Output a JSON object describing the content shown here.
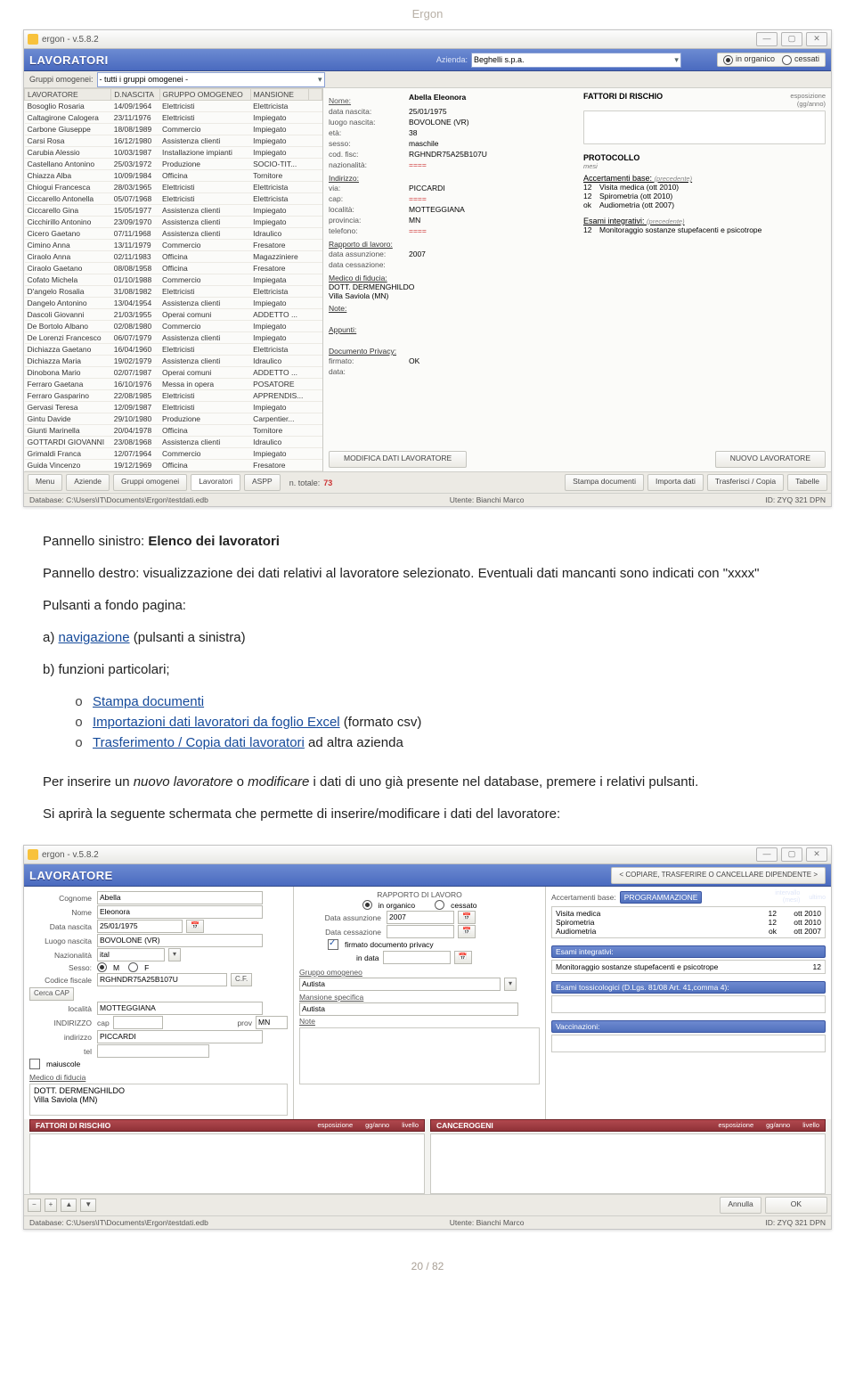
{
  "doc_header": "Ergon",
  "footer": "20 / 82",
  "app1": {
    "title": "ergon - v.5.8.2",
    "section": "LAVORATORI",
    "azienda_label": "Azienda:",
    "azienda_value": "Beghelli s.p.a.",
    "radio_in": "in organico",
    "radio_cess": "cessati",
    "groups_label": "Gruppi omogenei:",
    "groups_value": "- tutti i gruppi omogenei -",
    "headers": [
      "LAVORATORE",
      "D.NASCITA",
      "GRUPPO OMOGENEO",
      "MANSIONE"
    ],
    "rows": [
      [
        "Bosoglio Rosaria",
        "14/09/1964",
        "Elettricisti",
        "Elettricista"
      ],
      [
        "Caltagirone Calogera",
        "23/11/1976",
        "Elettricisti",
        "Impiegato"
      ],
      [
        "Carbone Giuseppe",
        "18/08/1989",
        "Commercio",
        "Impiegato"
      ],
      [
        "Carsi Rosa",
        "16/12/1980",
        "Assistenza clienti",
        "Impiegato"
      ],
      [
        "Carubia Alessio",
        "10/03/1987",
        "Installazione impianti",
        "Impiegato"
      ],
      [
        "Castellano Antonino",
        "25/03/1972",
        "Produzione",
        "SOCIO-TIT..."
      ],
      [
        "Chiazza Alba",
        "10/09/1984",
        "Officina",
        "Tornitore"
      ],
      [
        "Chiogui Francesca",
        "28/03/1965",
        "Elettricisti",
        "Elettricista"
      ],
      [
        "Ciccarello Antonella",
        "05/07/1968",
        "Elettricisti",
        "Elettricista"
      ],
      [
        "Ciccarello Gina",
        "15/05/1977",
        "Assistenza clienti",
        "Impiegato"
      ],
      [
        "Cicchirillo Antonino",
        "23/09/1970",
        "Assistenza clienti",
        "Impiegato"
      ],
      [
        "Cicero Gaetano",
        "07/11/1968",
        "Assistenza clienti",
        "Idraulico"
      ],
      [
        "Cimino Anna",
        "13/11/1979",
        "Commercio",
        "Fresatore"
      ],
      [
        "Ciraolo Anna",
        "02/11/1983",
        "Officina",
        "Magazziniere"
      ],
      [
        "Ciraolo Gaetano",
        "08/08/1958",
        "Officina",
        "Fresatore"
      ],
      [
        "Cofato Michela",
        "01/10/1988",
        "Commercio",
        "Impiegata"
      ],
      [
        "D'angelo Rosalia",
        "31/08/1982",
        "Elettricisti",
        "Elettricista"
      ],
      [
        "Dangelo Antonino",
        "13/04/1954",
        "Assistenza clienti",
        "Impiegato"
      ],
      [
        "Dascoli Giovanni",
        "21/03/1955",
        "Operai comuni",
        "ADDETTO ..."
      ],
      [
        "De Bortolo Albano",
        "02/08/1980",
        "Commercio",
        "Impiegato"
      ],
      [
        "De Lorenzi Francesco",
        "06/07/1979",
        "Assistenza clienti",
        "Impiegato"
      ],
      [
        "Dichiazza Gaetano",
        "16/04/1960",
        "Elettricisti",
        "Elettricista"
      ],
      [
        "Dichiazza Maria",
        "19/02/1979",
        "Assistenza clienti",
        "Idraulico"
      ],
      [
        "Dinobona Mario",
        "02/07/1987",
        "Operai comuni",
        "ADDETTO ..."
      ],
      [
        "Ferraro Gaetana",
        "16/10/1976",
        "Messa in opera",
        "POSATORE"
      ],
      [
        "Ferraro Gasparino",
        "22/08/1985",
        "Elettricisti",
        "APPRENDIS..."
      ],
      [
        "Gervasi Teresa",
        "12/09/1987",
        "Elettricisti",
        "Impiegato"
      ],
      [
        "Gintu Davide",
        "29/10/1980",
        "Produzione",
        "Carpentier..."
      ],
      [
        "Giunti Marinella",
        "20/04/1978",
        "Officina",
        "Tornitore"
      ],
      [
        "GOTTARDI GIOVANNI",
        "23/08/1968",
        "Assistenza clienti",
        "Idraulico"
      ],
      [
        "Grimaldi Franca",
        "12/07/1964",
        "Commercio",
        "Impiegato"
      ],
      [
        "Guida Vincenzo",
        "19/12/1969",
        "Officina",
        "Fresatore"
      ]
    ],
    "detail": {
      "name_lbl": "Nome:",
      "name": "Abella Eleonora",
      "dn_lbl": "data nascita:",
      "dn": "25/01/1975",
      "ln_lbl": "luogo nascita:",
      "ln": "BOVOLONE (VR)",
      "eta_lbl": "età:",
      "eta": "38",
      "sex_lbl": "sesso:",
      "sex": "maschile",
      "cf_lbl": "cod. fisc:",
      "cf": "RGHNDR75A25B107U",
      "naz_lbl": "nazionalità:",
      "naz": "====",
      "ind_hd": "Indirizzo:",
      "via_lbl": "via:",
      "via": "PICCARDI",
      "cap_lbl": "cap:",
      "cap": "====",
      "loc_lbl": "località:",
      "loc": "MOTTEGGIANA",
      "prov_lbl": "provincia:",
      "prov": "MN",
      "tel_lbl": "telefono:",
      "tel": "====",
      "rapp_hd": "Rapporto di lavoro:",
      "ass_lbl": "data assunzione:",
      "ass": "2007",
      "cess_lbl": "data cessazione:",
      "med_hd": "Medico di fiducia:",
      "med1": "DOTT. DERMENGHILDO",
      "med2": "Villa Saviola (MN)",
      "note_hd": "Note:",
      "app_hd": "Appunti:",
      "priv_hd": "Documento Privacy:",
      "priv_f_lbl": "firmato:",
      "priv_f": "OK",
      "priv_d_lbl": "data:"
    },
    "risk": {
      "hd": "FATTORI DI RISCHIO",
      "col1": "esposizione",
      "col2": "(gg/anno)",
      "proto_hd": "PROTOCOLLO",
      "proto_sub": "mesi",
      "acc_hd": "Accertamenti base:",
      "acc_sub": "(precedente)",
      "acc": [
        [
          "12",
          "Visita medica  (ott 2010)"
        ],
        [
          "12",
          "Spirometria  (ott 2010)"
        ],
        [
          "ok",
          "Audiometria  (ott 2007)"
        ]
      ],
      "int_hd": "Esami integrativi:",
      "int_sub": "(precedente)",
      "int": [
        [
          "12",
          "Monitoraggio sostanze stupefacenti e psicotrope"
        ]
      ]
    },
    "btn_modifica": "MODIFICA DATI LAVORATORE",
    "btn_nuovo": "NUOVO LAVORATORE",
    "bottom": {
      "menu": "Menu",
      "aziende": "Aziende",
      "gruppi": "Gruppi omogenei",
      "lav": "Lavoratori",
      "aspp": "ASPP",
      "ntot_lbl": "n. totale:",
      "ntot": "73",
      "stampa": "Stampa documenti",
      "importa": "Importa dati",
      "trasf": "Trasferisci / Copia",
      "tabelle": "Tabelle"
    },
    "status": {
      "db_lbl": "Database:",
      "db": "C:\\Users\\IT\\Documents\\Ergon\\testdati.edb",
      "ut_lbl": "Utente:",
      "ut": "Bianchi Marco",
      "id_lbl": "ID:",
      "id": "ZYQ 321 DPN"
    }
  },
  "article": {
    "p1a": "Pannello sinistro: ",
    "p1b": "Elenco dei lavoratori",
    "p2": "Pannello destro:  visualizzazione dei dati relativi al lavoratore selezionato. Eventuali dati mancanti sono indicati con \"xxxx\"",
    "p3": "Pulsanti a fondo pagina:",
    "p4a": "a) ",
    "p4link": "navigazione",
    "p4b": " (pulsanti a sinistra)",
    "p5": "b) funzioni particolari;",
    "b_o": "o",
    "li1": "Stampa documenti",
    "li2a": "Importazioni dati lavoratori da foglio Excel",
    "li2b": " (formato csv)",
    "li3a": "Trasferimento / Copia dati lavoratori",
    "li3b": " ad altra azienda",
    "p6a": "Per inserire un ",
    "p6b": "nuovo lavoratore",
    "p6c": " o ",
    "p6d": "modificare",
    "p6e": " i dati di uno già presente nel database, premere i relativi pulsanti.",
    "p7": "Si aprirà la seguente schermata che permette di inserire/modificare i dati del lavoratore:"
  },
  "app2": {
    "title": "ergon - v.5.8.2",
    "section": "LAVORATORE",
    "top_btn": "< COPIARE, TRASFERIRE O CANCELLARE DIPENDENTE >",
    "cognome_lbl": "Cognome",
    "cognome": "Abella",
    "nome_lbl": "Nome",
    "nome": "Eleonora",
    "dn_lbl": "Data nascita",
    "dn": "25/01/1975",
    "ln_lbl": "Luogo nascita",
    "ln": "BOVOLONE (VR)",
    "naz_lbl": "Nazionalità",
    "naz": "ital",
    "sex_lbl": "Sesso:",
    "sex_m": "M",
    "sex_f": "F",
    "cf_lbl": "Codice fiscale",
    "cf": "RGHNDR75A25B107U",
    "cf_btn": "C.F.",
    "cerca": "Cerca CAP",
    "loc_lbl": "località",
    "loc": "MOTTEGGIANA",
    "ind_lbl": "INDIRIZZO",
    "cap_lbl": "cap",
    "prov_lbl": "prov",
    "prov": "MN",
    "via_lbl": "indirizzo",
    "via": "PICCARDI",
    "tel_lbl": "tel",
    "maiusc": "maiuscole",
    "med_lbl": "Medico di fiducia",
    "med1": "DOTT. DERMENGHILDO",
    "med2": "Villa Saviola (MN)",
    "rapp_hd": "RAPPORTO DI LAVORO",
    "rio_in": "in organico",
    "rio_cess": "cessato",
    "da_lbl": "Data assunzione",
    "da": "2007",
    "dc_lbl": "Data cessazione",
    "priv_chk": "firmato documento privacy",
    "priv_data": "in data",
    "grp_lbl": "Gruppo omogeneo",
    "grp": "Autista",
    "mans_lbl": "Mansione specifica",
    "mans": "Autista",
    "note_lbl": "Note",
    "prog_hd": "Accertamenti base:",
    "prog_box": "PROGRAMMAZIONE",
    "prog_c1": "intervallo",
    "prog_c1b": "(mesi)",
    "prog_c2": "ultimo",
    "prog": [
      [
        "Visita medica",
        "12",
        "ott 2010"
      ],
      [
        "Spirometria",
        "12",
        "ott 2010"
      ],
      [
        "Audiometria",
        "ok",
        "ott 2007"
      ]
    ],
    "int_hd": "Esami integrativi:",
    "int": [
      [
        "Monitoraggio sostanze stupefacenti e psicotrope",
        "12"
      ]
    ],
    "tox_hd": "Esami tossicologici (D.Lgs. 81/08 Art. 41,comma 4):",
    "vac_hd": "Vaccinazioni:",
    "fatt_hd": "FATTORI DI RISCHIO",
    "fatt_c1": "esposizione",
    "fatt_c2": "gg/anno",
    "fatt_c3": "livello",
    "canc_hd": "CANCEROGENI",
    "ok": "OK",
    "annulla": "Annulla",
    "status": {
      "db_lbl": "Database:",
      "db": "C:\\Users\\IT\\Documents\\Ergon\\testdati.edb",
      "ut_lbl": "Utente:",
      "ut": "Bianchi Marco",
      "id_lbl": "ID:",
      "id": "ZYQ 321 DPN"
    }
  }
}
